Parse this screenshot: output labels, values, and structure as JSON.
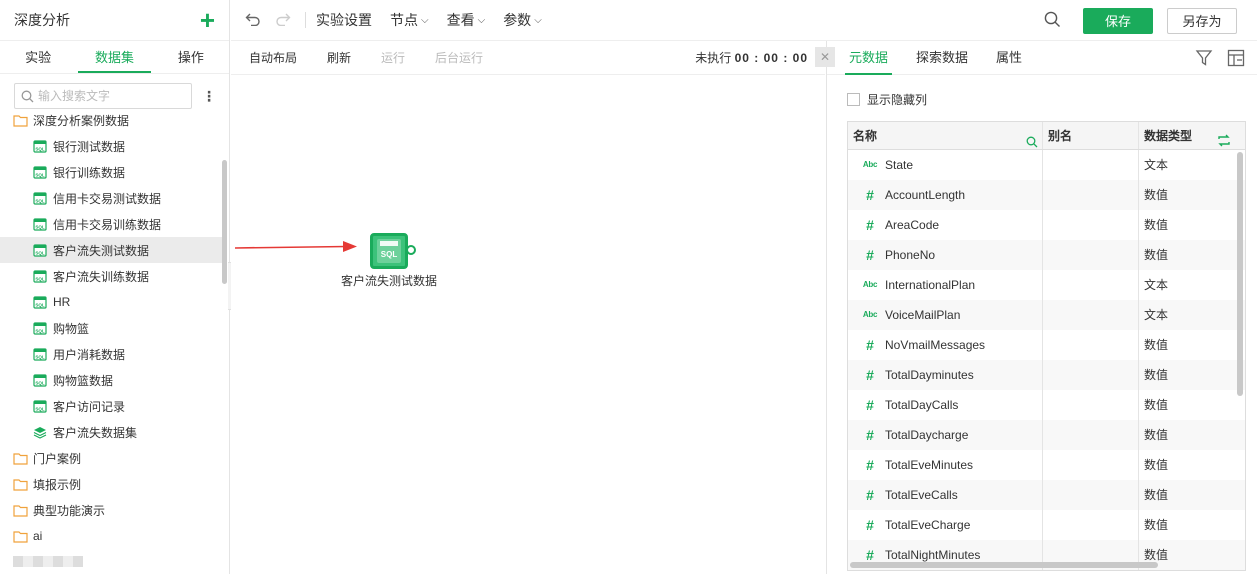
{
  "left": {
    "title": "深度分析",
    "add_symbol": "+",
    "tabs": [
      {
        "label": "实验",
        "active": false
      },
      {
        "label": "数据集",
        "active": true
      },
      {
        "label": "操作",
        "active": false
      }
    ],
    "search_placeholder": "输入搜索文字",
    "tree": [
      {
        "label": "深度分析案例数据",
        "icon": "folder-icon",
        "level": 0
      },
      {
        "label": "银行测试数据",
        "icon": "sql-table-icon",
        "level": 1
      },
      {
        "label": "银行训练数据",
        "icon": "sql-table-icon",
        "level": 1
      },
      {
        "label": "信用卡交易测试数据",
        "icon": "sql-table-icon",
        "level": 1
      },
      {
        "label": "信用卡交易训练数据",
        "icon": "sql-table-icon",
        "level": 1
      },
      {
        "label": "客户流失测试数据",
        "icon": "sql-table-icon",
        "level": 1,
        "selected": true
      },
      {
        "label": "客户流失训练数据",
        "icon": "sql-table-icon",
        "level": 1
      },
      {
        "label": "HR",
        "icon": "sql-table-icon",
        "level": 1
      },
      {
        "label": "购物篮",
        "icon": "sql-table-icon",
        "level": 1
      },
      {
        "label": "用户消耗数据",
        "icon": "sql-table-icon",
        "level": 1
      },
      {
        "label": "购物篮数据",
        "icon": "sql-table-icon",
        "level": 1
      },
      {
        "label": "客户访问记录",
        "icon": "sql-table-icon",
        "level": 1
      },
      {
        "label": "客户流失数据集",
        "icon": "dataset-stack-icon",
        "level": 1
      },
      {
        "label": "门户案例",
        "icon": "folder-icon",
        "level": 0
      },
      {
        "label": "填报示例",
        "icon": "folder-icon",
        "level": 0
      },
      {
        "label": "典型功能演示",
        "icon": "folder-icon",
        "level": 0
      },
      {
        "label": "ai",
        "icon": "folder-icon",
        "level": 0
      }
    ]
  },
  "toolbar": {
    "menus": [
      {
        "label": "实验设置",
        "has_dropdown": false
      },
      {
        "label": "节点",
        "has_dropdown": true
      },
      {
        "label": "查看",
        "has_dropdown": true
      },
      {
        "label": "参数",
        "has_dropdown": true
      }
    ],
    "save_label": "保存",
    "save_as_label": "另存为"
  },
  "subbar": {
    "buttons": [
      {
        "label": "自动布局",
        "enabled": true
      },
      {
        "label": "刷新",
        "enabled": true
      },
      {
        "label": "运行",
        "enabled": false
      },
      {
        "label": "后台运行",
        "enabled": false
      }
    ],
    "status_label": "未执行",
    "status_time": "00 : 00 : 00"
  },
  "canvas": {
    "node_label": "客户流失测试数据",
    "node_icon_text": "SQL"
  },
  "right": {
    "tabs": [
      {
        "label": "元数据",
        "active": true
      },
      {
        "label": "探索数据",
        "active": false
      },
      {
        "label": "属性",
        "active": false
      }
    ],
    "show_hidden_label": "显示隐藏列",
    "columns": [
      "名称",
      "别名",
      "数据类型"
    ],
    "rows": [
      {
        "type_icon": "Abc",
        "name": "State",
        "alias": "",
        "dtype": "文本"
      },
      {
        "type_icon": "#",
        "name": "AccountLength",
        "alias": "",
        "dtype": "数值"
      },
      {
        "type_icon": "#",
        "name": "AreaCode",
        "alias": "",
        "dtype": "数值"
      },
      {
        "type_icon": "#",
        "name": "PhoneNo",
        "alias": "",
        "dtype": "数值"
      },
      {
        "type_icon": "Abc",
        "name": "InternationalPlan",
        "alias": "",
        "dtype": "文本"
      },
      {
        "type_icon": "Abc",
        "name": "VoiceMailPlan",
        "alias": "",
        "dtype": "文本"
      },
      {
        "type_icon": "#",
        "name": "NoVmailMessages",
        "alias": "",
        "dtype": "数值"
      },
      {
        "type_icon": "#",
        "name": "TotalDayminutes",
        "alias": "",
        "dtype": "数值"
      },
      {
        "type_icon": "#",
        "name": "TotalDayCalls",
        "alias": "",
        "dtype": "数值"
      },
      {
        "type_icon": "#",
        "name": "TotalDaycharge",
        "alias": "",
        "dtype": "数值"
      },
      {
        "type_icon": "#",
        "name": "TotalEveMinutes",
        "alias": "",
        "dtype": "数值"
      },
      {
        "type_icon": "#",
        "name": "TotalEveCalls",
        "alias": "",
        "dtype": "数值"
      },
      {
        "type_icon": "#",
        "name": "TotalEveCharge",
        "alias": "",
        "dtype": "数值"
      },
      {
        "type_icon": "#",
        "name": "TotalNightMinutes",
        "alias": "",
        "dtype": "数值"
      }
    ]
  },
  "colors": {
    "accent": "#1aab5b",
    "folder": "#f0a23c",
    "arrow": "#e53935"
  }
}
